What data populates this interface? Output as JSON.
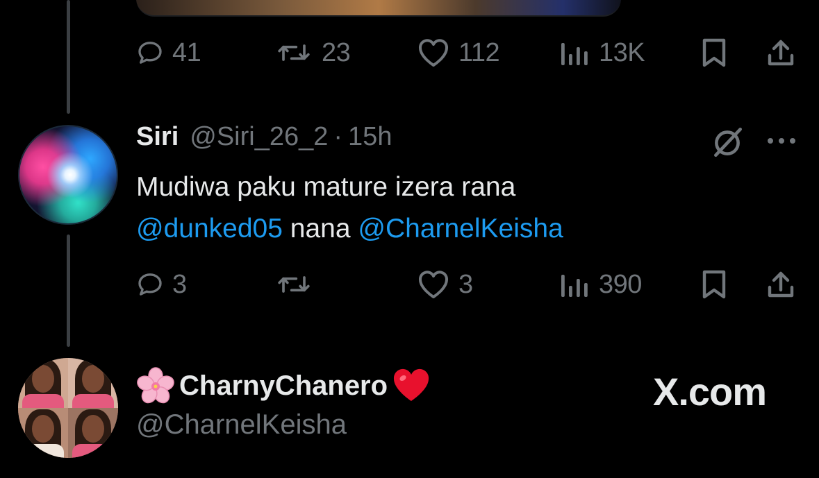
{
  "previous_tweet": {
    "actions": {
      "replies": "41",
      "reposts": "23",
      "likes": "112",
      "views": "13K"
    }
  },
  "reply_tweet": {
    "display_name": "Siri",
    "handle": "@Siri_26_2",
    "separator": "·",
    "time": "15h",
    "text_line1": "Mudiwa paku mature izera rana",
    "mention1": "@dunked05",
    "text_middle": "nana",
    "mention2": "@CharnelKeisha",
    "actions": {
      "replies": "3",
      "reposts": "",
      "likes": "3",
      "views": "390"
    }
  },
  "profile": {
    "display_name": "CharnyChanero",
    "handle": "@CharnelKeisha",
    "brand": "X.com"
  },
  "colors": {
    "background": "#000000",
    "text_primary": "#e7e9ea",
    "text_secondary": "#71767b",
    "link": "#1d9bf0",
    "thread_line": "#3b3f43"
  },
  "icons": {
    "reply": "reply-icon",
    "repost": "repost-icon",
    "like": "heart-icon",
    "views": "views-icon",
    "bookmark": "bookmark-icon",
    "share": "share-icon",
    "grok": "grok-icon",
    "more": "more-icon"
  }
}
